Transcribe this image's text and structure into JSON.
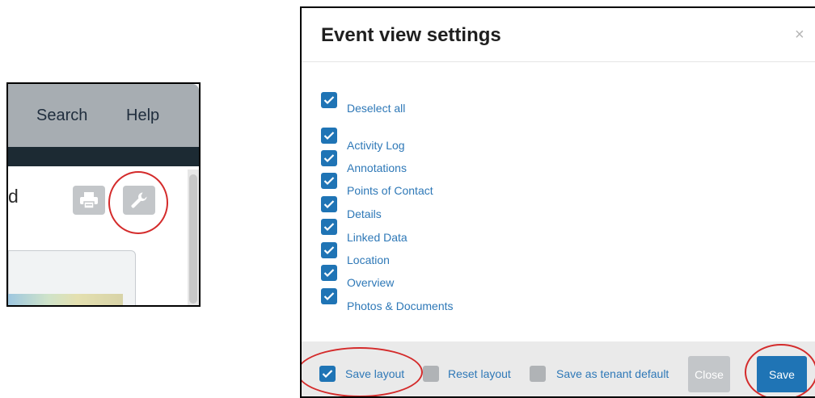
{
  "crop": {
    "nav": {
      "search": "Search",
      "help": "Help"
    },
    "partial_text": "d",
    "icons": {
      "print": "print-icon",
      "settings": "wrench-icon"
    }
  },
  "modal": {
    "title": "Event view settings",
    "close_glyph": "×",
    "deselect_all": "Deselect all",
    "items": [
      "Activity Log",
      "Annotations",
      "Points of Contact",
      "Details",
      "Linked Data",
      "Location",
      "Overview",
      "Photos & Documents"
    ],
    "footer": {
      "save_layout": "Save layout",
      "reset_layout": "Reset layout",
      "save_tenant_default": "Save as tenant default",
      "close_button": "Close",
      "save_button": "Save"
    }
  },
  "colors": {
    "accent": "#1f74b5",
    "annotation": "#d42b2b",
    "nav_bg": "#a7adb2",
    "dark_bar": "#1c2a33"
  }
}
